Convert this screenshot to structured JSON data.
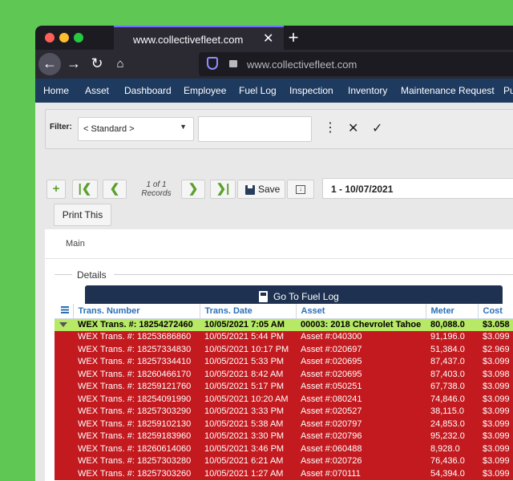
{
  "browser": {
    "tab_title": "www.collectivefleet.com",
    "url": "www.collectivefleet.com"
  },
  "menu": [
    "Home",
    "Asset",
    "Dashboard",
    "Employee",
    "Fuel Log",
    "Inspection",
    "Inventory",
    "Maintenance Request",
    "Pu"
  ],
  "filter": {
    "label": "Filter:",
    "selected": "< Standard >",
    "value": ""
  },
  "toolbar": {
    "records_count": "1 of 1",
    "records_label": "Records",
    "save_label": "Save",
    "print_label": "Print This",
    "record_value": "1 - 10/07/2021"
  },
  "tabs": {
    "main": "Main"
  },
  "details": {
    "label": "Details",
    "fuel_log_button": "Go To Fuel Log"
  },
  "grid": {
    "columns": [
      "Trans. Number",
      "Trans. Date",
      "Asset",
      "Meter",
      "Cost"
    ],
    "rows": [
      [
        "WEX Trans. #: 18254272460",
        "10/05/2021 7:05 AM",
        "00003: 2018 Chevrolet Tahoe",
        "80,088.0",
        "$3.058"
      ],
      [
        "WEX Trans. #: 18253686860",
        "10/05/2021 5:44 PM",
        "Asset #:040300",
        "91,196.0",
        "$3.099"
      ],
      [
        "WEX Trans. #: 18257334830",
        "10/05/2021 10:17 PM",
        "Asset #:020697",
        "51,384.0",
        "$2.969"
      ],
      [
        "WEX Trans. #: 18257334410",
        "10/05/2021 5:33 PM",
        "Asset #:020695",
        "87,437.0",
        "$3.099"
      ],
      [
        "WEX Trans. #: 18260466170",
        "10/05/2021 8:42 AM",
        "Asset #:020695",
        "87,403.0",
        "$3.098"
      ],
      [
        "WEX Trans. #: 18259121760",
        "10/05/2021 5:17 PM",
        "Asset #:050251",
        "67,738.0",
        "$3.099"
      ],
      [
        "WEX Trans. #: 18254091990",
        "10/05/2021 10:20 AM",
        "Asset #:080241",
        "74,846.0",
        "$3.099"
      ],
      [
        "WEX Trans. #: 18257303290",
        "10/05/2021 3:33 PM",
        "Asset #:020527",
        "38,115.0",
        "$3.099"
      ],
      [
        "WEX Trans. #: 18259102130",
        "10/05/2021 5:38 AM",
        "Asset #:020797",
        "24,853.0",
        "$3.099"
      ],
      [
        "WEX Trans. #: 18259183960",
        "10/05/2021 3:30 PM",
        "Asset #:020796",
        "95,232.0",
        "$3.099"
      ],
      [
        "WEX Trans. #: 18260614060",
        "10/05/2021 3:46 PM",
        "Asset #:060488",
        "8,928.0",
        "$3.099"
      ],
      [
        "WEX Trans. #: 18257303280",
        "10/05/2021 6:21 AM",
        "Asset #:020726",
        "76,436.0",
        "$3.099"
      ],
      [
        "WEX Trans. #: 18257303260",
        "10/05/2021 1:27 AM",
        "Asset #:070111",
        "54,394.0",
        "$3.099"
      ]
    ]
  },
  "colors": {
    "menu_bg": "#1e3a5f",
    "selected_row": "#b7e866",
    "alert_row": "#c21a1f",
    "accent_link": "#2a6fb8",
    "desktop_bg": "#5fc855"
  }
}
